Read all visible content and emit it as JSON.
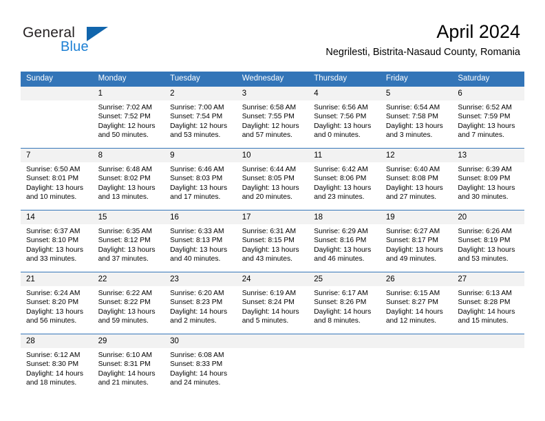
{
  "brand": {
    "name_part1": "General",
    "name_part2": "Blue",
    "logo_icon": "blue-triangle-logo"
  },
  "header": {
    "title": "April 2024",
    "location": "Negrilesti, Bistrita-Nasaud County, Romania"
  },
  "colors": {
    "header_row_background": "#3375b8",
    "header_row_text": "#ffffff",
    "daynumber_background": "#f2f2f2",
    "brand_blue": "#1b7fd4",
    "logo_blue": "#1165ac",
    "grid_line": "#3375b8",
    "page_background": "#ffffff",
    "body_text": "#000000"
  },
  "weekday_headers": [
    "Sunday",
    "Monday",
    "Tuesday",
    "Wednesday",
    "Thursday",
    "Friday",
    "Saturday"
  ],
  "weeks": [
    [
      {
        "day": "",
        "empty": true,
        "sunrise": "",
        "sunset": "",
        "daylight_line1": "",
        "daylight_line2": ""
      },
      {
        "day": "1",
        "empty": false,
        "sunrise": "Sunrise: 7:02 AM",
        "sunset": "Sunset: 7:52 PM",
        "daylight_line1": "Daylight: 12 hours",
        "daylight_line2": "and 50 minutes."
      },
      {
        "day": "2",
        "empty": false,
        "sunrise": "Sunrise: 7:00 AM",
        "sunset": "Sunset: 7:54 PM",
        "daylight_line1": "Daylight: 12 hours",
        "daylight_line2": "and 53 minutes."
      },
      {
        "day": "3",
        "empty": false,
        "sunrise": "Sunrise: 6:58 AM",
        "sunset": "Sunset: 7:55 PM",
        "daylight_line1": "Daylight: 12 hours",
        "daylight_line2": "and 57 minutes."
      },
      {
        "day": "4",
        "empty": false,
        "sunrise": "Sunrise: 6:56 AM",
        "sunset": "Sunset: 7:56 PM",
        "daylight_line1": "Daylight: 13 hours",
        "daylight_line2": "and 0 minutes."
      },
      {
        "day": "5",
        "empty": false,
        "sunrise": "Sunrise: 6:54 AM",
        "sunset": "Sunset: 7:58 PM",
        "daylight_line1": "Daylight: 13 hours",
        "daylight_line2": "and 3 minutes."
      },
      {
        "day": "6",
        "empty": false,
        "sunrise": "Sunrise: 6:52 AM",
        "sunset": "Sunset: 7:59 PM",
        "daylight_line1": "Daylight: 13 hours",
        "daylight_line2": "and 7 minutes."
      }
    ],
    [
      {
        "day": "7",
        "empty": false,
        "sunrise": "Sunrise: 6:50 AM",
        "sunset": "Sunset: 8:01 PM",
        "daylight_line1": "Daylight: 13 hours",
        "daylight_line2": "and 10 minutes."
      },
      {
        "day": "8",
        "empty": false,
        "sunrise": "Sunrise: 6:48 AM",
        "sunset": "Sunset: 8:02 PM",
        "daylight_line1": "Daylight: 13 hours",
        "daylight_line2": "and 13 minutes."
      },
      {
        "day": "9",
        "empty": false,
        "sunrise": "Sunrise: 6:46 AM",
        "sunset": "Sunset: 8:03 PM",
        "daylight_line1": "Daylight: 13 hours",
        "daylight_line2": "and 17 minutes."
      },
      {
        "day": "10",
        "empty": false,
        "sunrise": "Sunrise: 6:44 AM",
        "sunset": "Sunset: 8:05 PM",
        "daylight_line1": "Daylight: 13 hours",
        "daylight_line2": "and 20 minutes."
      },
      {
        "day": "11",
        "empty": false,
        "sunrise": "Sunrise: 6:42 AM",
        "sunset": "Sunset: 8:06 PM",
        "daylight_line1": "Daylight: 13 hours",
        "daylight_line2": "and 23 minutes."
      },
      {
        "day": "12",
        "empty": false,
        "sunrise": "Sunrise: 6:40 AM",
        "sunset": "Sunset: 8:08 PM",
        "daylight_line1": "Daylight: 13 hours",
        "daylight_line2": "and 27 minutes."
      },
      {
        "day": "13",
        "empty": false,
        "sunrise": "Sunrise: 6:39 AM",
        "sunset": "Sunset: 8:09 PM",
        "daylight_line1": "Daylight: 13 hours",
        "daylight_line2": "and 30 minutes."
      }
    ],
    [
      {
        "day": "14",
        "empty": false,
        "sunrise": "Sunrise: 6:37 AM",
        "sunset": "Sunset: 8:10 PM",
        "daylight_line1": "Daylight: 13 hours",
        "daylight_line2": "and 33 minutes."
      },
      {
        "day": "15",
        "empty": false,
        "sunrise": "Sunrise: 6:35 AM",
        "sunset": "Sunset: 8:12 PM",
        "daylight_line1": "Daylight: 13 hours",
        "daylight_line2": "and 37 minutes."
      },
      {
        "day": "16",
        "empty": false,
        "sunrise": "Sunrise: 6:33 AM",
        "sunset": "Sunset: 8:13 PM",
        "daylight_line1": "Daylight: 13 hours",
        "daylight_line2": "and 40 minutes."
      },
      {
        "day": "17",
        "empty": false,
        "sunrise": "Sunrise: 6:31 AM",
        "sunset": "Sunset: 8:15 PM",
        "daylight_line1": "Daylight: 13 hours",
        "daylight_line2": "and 43 minutes."
      },
      {
        "day": "18",
        "empty": false,
        "sunrise": "Sunrise: 6:29 AM",
        "sunset": "Sunset: 8:16 PM",
        "daylight_line1": "Daylight: 13 hours",
        "daylight_line2": "and 46 minutes."
      },
      {
        "day": "19",
        "empty": false,
        "sunrise": "Sunrise: 6:27 AM",
        "sunset": "Sunset: 8:17 PM",
        "daylight_line1": "Daylight: 13 hours",
        "daylight_line2": "and 49 minutes."
      },
      {
        "day": "20",
        "empty": false,
        "sunrise": "Sunrise: 6:26 AM",
        "sunset": "Sunset: 8:19 PM",
        "daylight_line1": "Daylight: 13 hours",
        "daylight_line2": "and 53 minutes."
      }
    ],
    [
      {
        "day": "21",
        "empty": false,
        "sunrise": "Sunrise: 6:24 AM",
        "sunset": "Sunset: 8:20 PM",
        "daylight_line1": "Daylight: 13 hours",
        "daylight_line2": "and 56 minutes."
      },
      {
        "day": "22",
        "empty": false,
        "sunrise": "Sunrise: 6:22 AM",
        "sunset": "Sunset: 8:22 PM",
        "daylight_line1": "Daylight: 13 hours",
        "daylight_line2": "and 59 minutes."
      },
      {
        "day": "23",
        "empty": false,
        "sunrise": "Sunrise: 6:20 AM",
        "sunset": "Sunset: 8:23 PM",
        "daylight_line1": "Daylight: 14 hours",
        "daylight_line2": "and 2 minutes."
      },
      {
        "day": "24",
        "empty": false,
        "sunrise": "Sunrise: 6:19 AM",
        "sunset": "Sunset: 8:24 PM",
        "daylight_line1": "Daylight: 14 hours",
        "daylight_line2": "and 5 minutes."
      },
      {
        "day": "25",
        "empty": false,
        "sunrise": "Sunrise: 6:17 AM",
        "sunset": "Sunset: 8:26 PM",
        "daylight_line1": "Daylight: 14 hours",
        "daylight_line2": "and 8 minutes."
      },
      {
        "day": "26",
        "empty": false,
        "sunrise": "Sunrise: 6:15 AM",
        "sunset": "Sunset: 8:27 PM",
        "daylight_line1": "Daylight: 14 hours",
        "daylight_line2": "and 12 minutes."
      },
      {
        "day": "27",
        "empty": false,
        "sunrise": "Sunrise: 6:13 AM",
        "sunset": "Sunset: 8:28 PM",
        "daylight_line1": "Daylight: 14 hours",
        "daylight_line2": "and 15 minutes."
      }
    ],
    [
      {
        "day": "28",
        "empty": false,
        "sunrise": "Sunrise: 6:12 AM",
        "sunset": "Sunset: 8:30 PM",
        "daylight_line1": "Daylight: 14 hours",
        "daylight_line2": "and 18 minutes."
      },
      {
        "day": "29",
        "empty": false,
        "sunrise": "Sunrise: 6:10 AM",
        "sunset": "Sunset: 8:31 PM",
        "daylight_line1": "Daylight: 14 hours",
        "daylight_line2": "and 21 minutes."
      },
      {
        "day": "30",
        "empty": false,
        "sunrise": "Sunrise: 6:08 AM",
        "sunset": "Sunset: 8:33 PM",
        "daylight_line1": "Daylight: 14 hours",
        "daylight_line2": "and 24 minutes."
      },
      {
        "day": "",
        "empty": true,
        "sunrise": "",
        "sunset": "",
        "daylight_line1": "",
        "daylight_line2": ""
      },
      {
        "day": "",
        "empty": true,
        "sunrise": "",
        "sunset": "",
        "daylight_line1": "",
        "daylight_line2": ""
      },
      {
        "day": "",
        "empty": true,
        "sunrise": "",
        "sunset": "",
        "daylight_line1": "",
        "daylight_line2": ""
      },
      {
        "day": "",
        "empty": true,
        "sunrise": "",
        "sunset": "",
        "daylight_line1": "",
        "daylight_line2": ""
      }
    ]
  ]
}
